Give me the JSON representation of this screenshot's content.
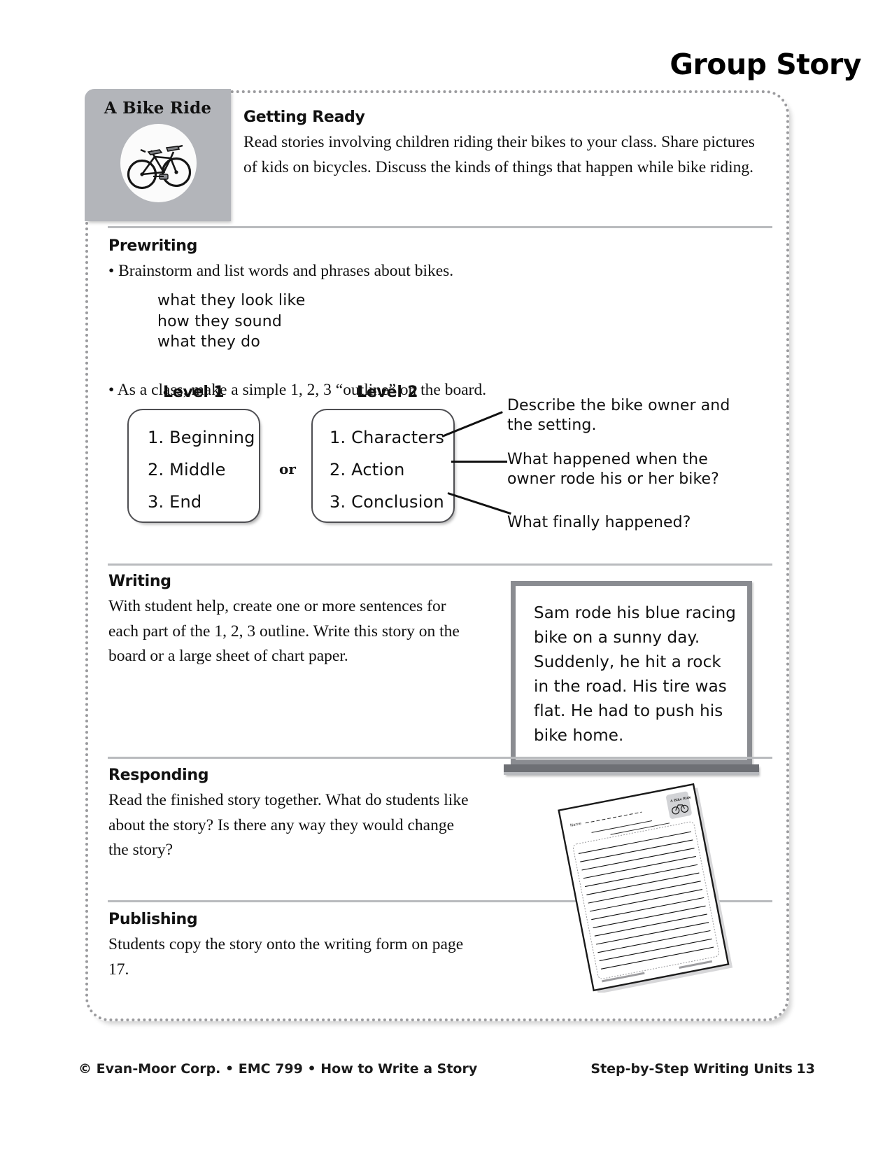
{
  "header": {
    "page_title": "Group Story"
  },
  "unit": {
    "badge_title": "A Bike Ride",
    "badge_icon": "bicycle-icon"
  },
  "sections": {
    "getting_ready": {
      "heading": "Getting Ready",
      "body": "Read stories involving children riding their bikes to your class. Share pictures of kids on bicycles. Discuss the kinds of things that happen while bike riding."
    },
    "prewriting": {
      "heading": "Prewriting",
      "bullet_1": "• Brainstorm and list words and phrases about bikes.",
      "word_list": [
        "what they look like",
        "how they sound",
        "what they do"
      ],
      "bullet_2": "• As a class, make a simple 1, 2, 3 “outline” on the board."
    },
    "writing": {
      "heading": "Writing",
      "body": "With student help, create one or more sentences for each part of the 1, 2, 3 outline. Write this story on the board or a large sheet of chart paper."
    },
    "responding": {
      "heading": "Responding",
      "body": "Read the finished story together. What do students like about the story? Is there any way they would change the story?"
    },
    "publishing": {
      "heading": "Publishing",
      "body": "Students copy the story onto the writing form on page 17."
    }
  },
  "outline": {
    "level1_label": "Level 1",
    "level2_label": "Level 2",
    "or_label": "or",
    "level1_items": [
      "1. Beginning",
      "2. Middle",
      "3. End"
    ],
    "level2_items": [
      "1. Characters",
      "2. Action",
      "3. Conclusion"
    ],
    "callouts": [
      "Describe the bike owner and the setting.",
      "What happened when the owner rode his or her bike?",
      "What finally happened?"
    ]
  },
  "chalkboard": {
    "lines": [
      "Sam rode his blue racing",
      "bike on a sunny day.",
      "Suddenly, he hit a rock",
      "in the road. His tire was",
      "flat. He had to push his",
      "bike home."
    ]
  },
  "form_illustration": {
    "name_label": "Name",
    "badge_label": "A Bike Ride",
    "badge_icon": "bicycle-icon"
  },
  "footer": {
    "left": "© Evan-Moor Corp. • EMC 799 • How to Write a Story",
    "right": "Step-by-Step Writing Units",
    "page_number": "13"
  },
  "colors": {
    "badge_gray": "#b3b5ba",
    "rule_gray": "#b9bbbe",
    "frame_dot_gray": "#9b9b9e",
    "chalk_frame_gray": "#8a8c91",
    "chalk_ledge_gray": "#6e7075"
  }
}
